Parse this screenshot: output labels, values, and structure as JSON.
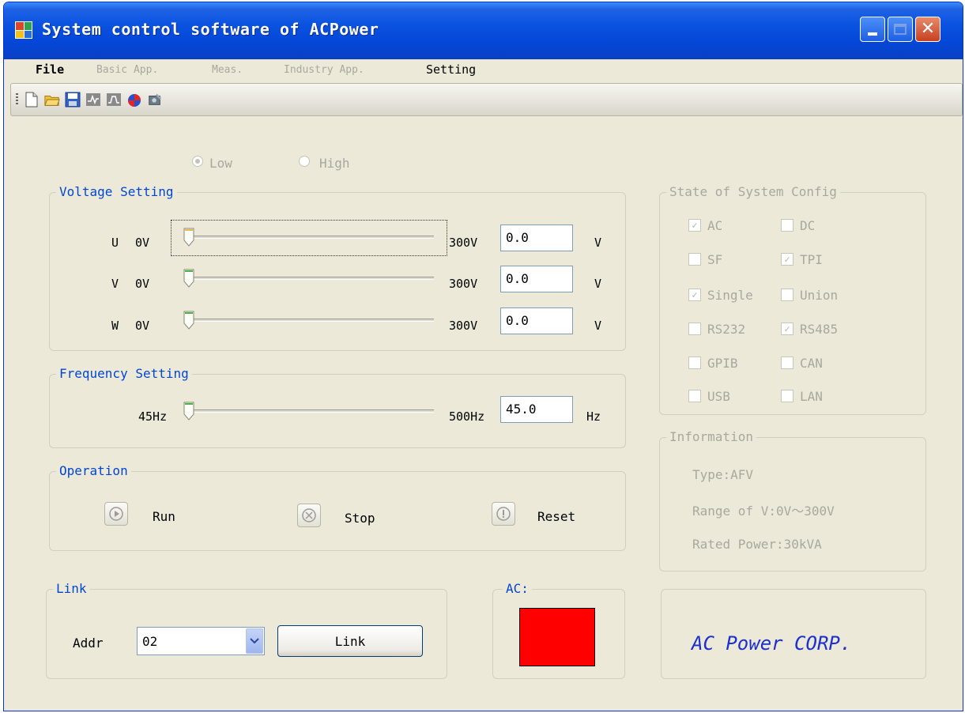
{
  "window": {
    "title": "System control software of ACPower"
  },
  "menu": {
    "items": [
      {
        "label": "File",
        "enabled": true
      },
      {
        "label": "Basic App.",
        "enabled": false
      },
      {
        "label": "Meas.",
        "enabled": false
      },
      {
        "label": "Industry App.",
        "enabled": false
      },
      {
        "label": "Setting",
        "enabled": true
      }
    ]
  },
  "toolbar": {
    "icons": [
      "new-file-icon",
      "open-folder-icon",
      "save-icon",
      "waveform-icon",
      "pulse-icon",
      "connect-icon",
      "tools-icon"
    ]
  },
  "range": {
    "low_label": "Low",
    "high_label": "High",
    "selected": "Low"
  },
  "voltage": {
    "title": "Voltage Setting",
    "rows": [
      {
        "phase": "U",
        "min": "0V",
        "max": "300V",
        "value": "0.0",
        "unit": "V",
        "level": 0
      },
      {
        "phase": "V",
        "min": "0V",
        "max": "300V",
        "value": "0.0",
        "unit": "V",
        "level": 0
      },
      {
        "phase": "W",
        "min": "0V",
        "max": "300V",
        "value": "0.0",
        "unit": "V",
        "level": 0
      }
    ]
  },
  "frequency": {
    "title": "Frequency Setting",
    "min": "45Hz",
    "max": "500Hz",
    "value": "45.0",
    "unit": "Hz",
    "level": 0
  },
  "operation": {
    "title": "Operation",
    "run_label": "Run",
    "stop_label": "Stop",
    "reset_label": "Reset"
  },
  "link": {
    "title": "Link",
    "addr_label": "Addr",
    "addr_value": "02",
    "button_label": "Link"
  },
  "ac": {
    "title": "AC:",
    "indicator_color": "#ff0000"
  },
  "system_config": {
    "title": "State of System Config",
    "items": [
      {
        "label": "AC",
        "checked": true
      },
      {
        "label": "DC",
        "checked": false
      },
      {
        "label": "SF",
        "checked": false
      },
      {
        "label": "TPI",
        "checked": true
      },
      {
        "label": "Single",
        "checked": true
      },
      {
        "label": "Union",
        "checked": false
      },
      {
        "label": "RS232",
        "checked": false
      },
      {
        "label": "RS485",
        "checked": true
      },
      {
        "label": "GPIB",
        "checked": false
      },
      {
        "label": "CAN",
        "checked": false
      },
      {
        "label": "USB",
        "checked": false
      },
      {
        "label": "LAN",
        "checked": false
      }
    ]
  },
  "information": {
    "title": "Information",
    "type": "Type:AFV",
    "range": "Range of V:0V～300V",
    "rated_power": "Rated Power:30kVA"
  },
  "brand": {
    "text": "AC Power CORP."
  },
  "colors": {
    "title_bar": "#0a52e0",
    "group_label": "#0046d5",
    "brand_text": "#1c2fd0",
    "disabled_text": "#a9a89c"
  }
}
